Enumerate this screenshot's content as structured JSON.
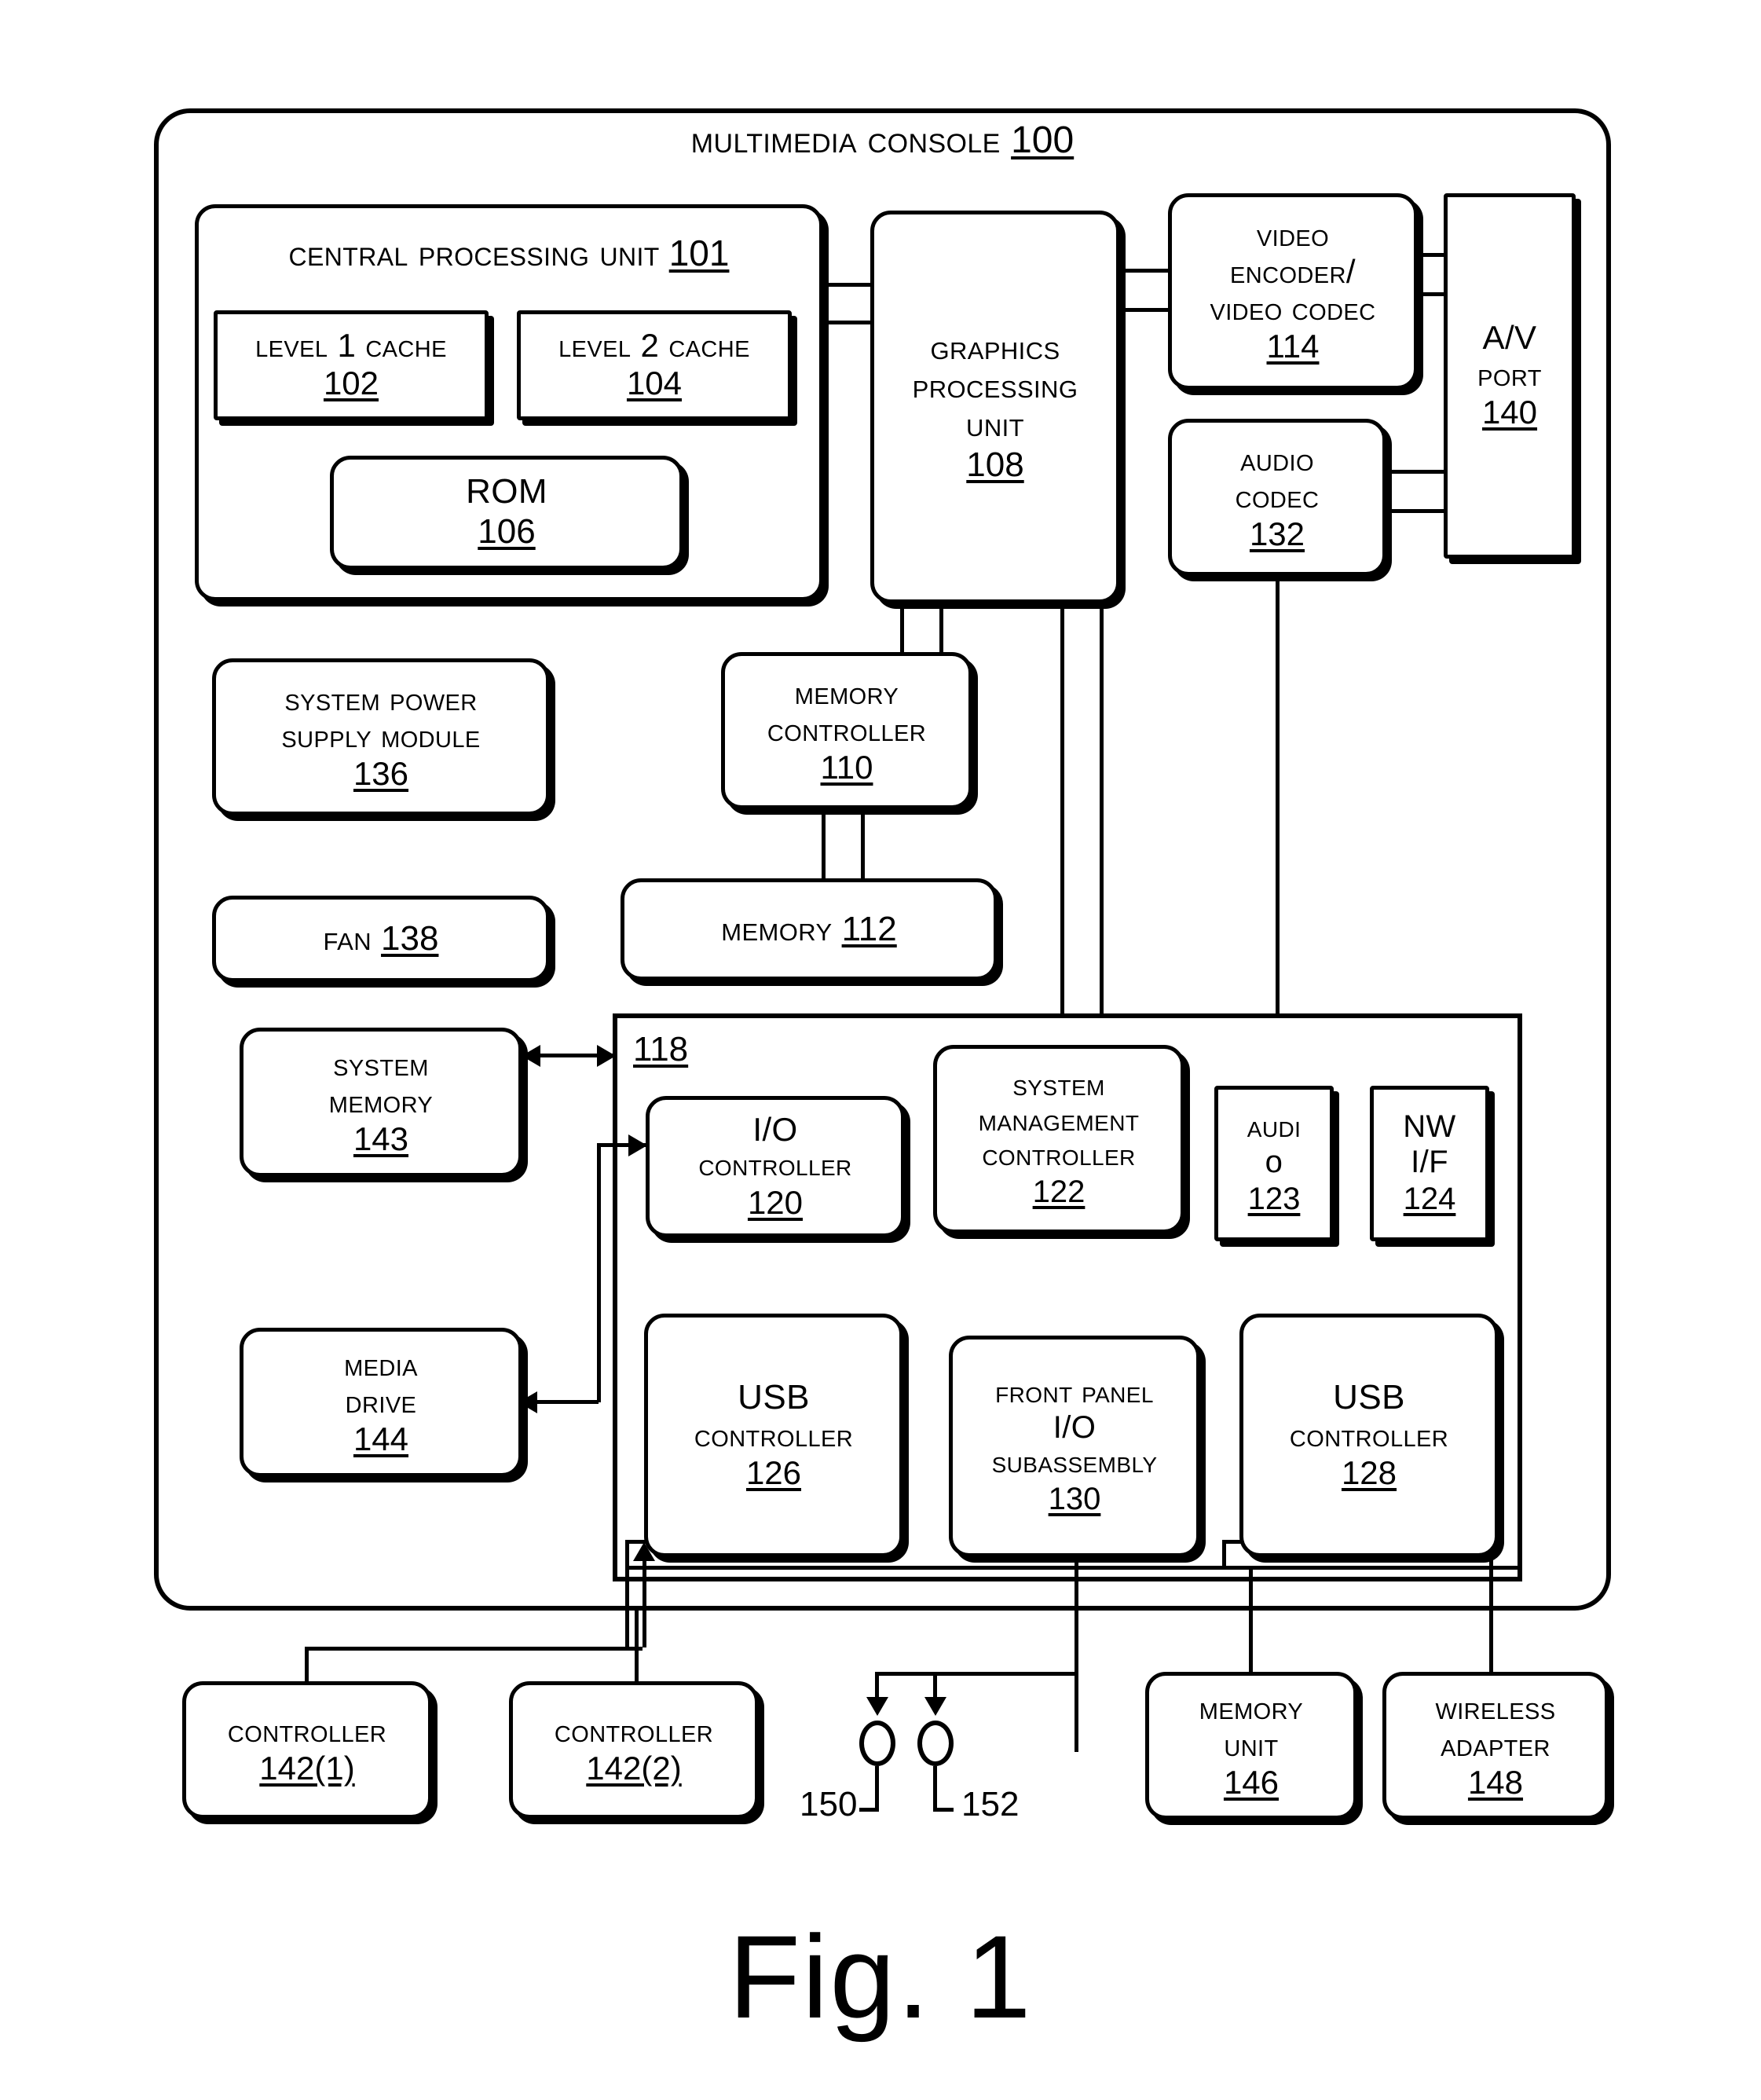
{
  "figure": {
    "caption": "Fig. 1",
    "title": "Multimedia Console",
    "title_number": "100"
  },
  "blocks": {
    "cpu": {
      "lines": [
        "Central Processing Unit"
      ],
      "number": "101"
    },
    "l1_cache": {
      "lines": [
        "Level 1 Cache"
      ],
      "number": "102"
    },
    "l2_cache": {
      "lines": [
        "Level 2 Cache"
      ],
      "number": "104"
    },
    "rom": {
      "lines": [
        "ROM"
      ],
      "number": "106"
    },
    "gpu": {
      "lines": [
        "Graphics",
        "Processing",
        "Unit"
      ],
      "number": "108"
    },
    "video_encoder": {
      "lines": [
        "Video",
        "Encoder/",
        "Video Codec"
      ],
      "number": "114"
    },
    "audio_codec": {
      "lines": [
        "Audio",
        "Codec"
      ],
      "number": "132"
    },
    "av_port": {
      "lines": [
        "A/V",
        "Port"
      ],
      "number": "140"
    },
    "power_supply": {
      "lines": [
        "System Power",
        "Supply Module"
      ],
      "number": "136"
    },
    "fan": {
      "lines": [
        "Fan"
      ],
      "number": "138"
    },
    "memory_controller": {
      "lines": [
        "Memory",
        "Controller"
      ],
      "number": "110"
    },
    "memory": {
      "lines": [
        "Memory"
      ],
      "number": "112"
    },
    "system_memory": {
      "lines": [
        "System",
        "Memory"
      ],
      "number": "143"
    },
    "media_drive": {
      "lines": [
        "Media",
        "Drive"
      ],
      "number": "144"
    },
    "io_controller": {
      "lines": [
        "I/O",
        "Controller"
      ],
      "number": "120"
    },
    "sys_mgmt_controller": {
      "lines": [
        "System",
        "Management",
        "Controller"
      ],
      "number": "122"
    },
    "audio": {
      "lines": [
        "Audi",
        "o"
      ],
      "number": "123"
    },
    "nw_if": {
      "lines": [
        "NW",
        "I/F"
      ],
      "number": "124"
    },
    "usb_controller_1": {
      "lines": [
        "USB",
        "Controller"
      ],
      "number": "126"
    },
    "front_panel": {
      "lines": [
        "Front Panel",
        "I/O",
        "Subassembly"
      ],
      "number": "130"
    },
    "usb_controller_2": {
      "lines": [
        "USB",
        "Controller"
      ],
      "number": "128"
    },
    "controller_1": {
      "lines": [
        "Controller"
      ],
      "number": "142(1)"
    },
    "controller_2": {
      "lines": [
        "Controller"
      ],
      "number": "142(2)"
    },
    "memory_unit": {
      "lines": [
        "Memory",
        "Unit"
      ],
      "number": "146"
    },
    "wireless_adapter": {
      "lines": [
        "Wireless",
        "Adapter"
      ],
      "number": "148"
    },
    "io_subsystem": {
      "number": "118"
    }
  },
  "connectors": {
    "c150": "150",
    "c152": "152"
  },
  "colors": {
    "ink": "#000000",
    "paper": "#ffffff"
  }
}
